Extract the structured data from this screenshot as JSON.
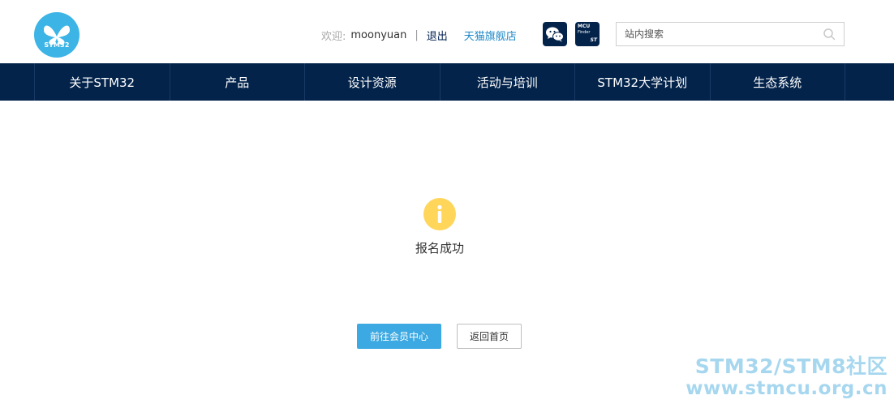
{
  "header": {
    "logo_text": "STM32",
    "welcome_label": "欢迎:",
    "username": "moonyuan",
    "separator": "|",
    "logout_label": "退出",
    "tmall_label": "天猫旗舰店",
    "mcu_badge": {
      "line1": "MCU",
      "line2": "Finder",
      "brand": "ST"
    },
    "search": {
      "placeholder": "站内搜索"
    }
  },
  "nav": {
    "items": [
      {
        "label": "关于STM32"
      },
      {
        "label": "产品"
      },
      {
        "label": "设计资源"
      },
      {
        "label": "活动与培训"
      },
      {
        "label": "STM32大学计划"
      },
      {
        "label": "生态系统"
      }
    ]
  },
  "main": {
    "message": "报名成功",
    "primary_button": "前往会员中心",
    "secondary_button": "返回首页"
  },
  "watermark": {
    "line1": "STM32/STM8社区",
    "line2": "www.stmcu.org.cn"
  },
  "colors": {
    "brand_blue": "#3cb4e6",
    "nav_bg": "#03234b",
    "info_icon": "#ffd55a",
    "primary_button": "#3ca9e2"
  }
}
